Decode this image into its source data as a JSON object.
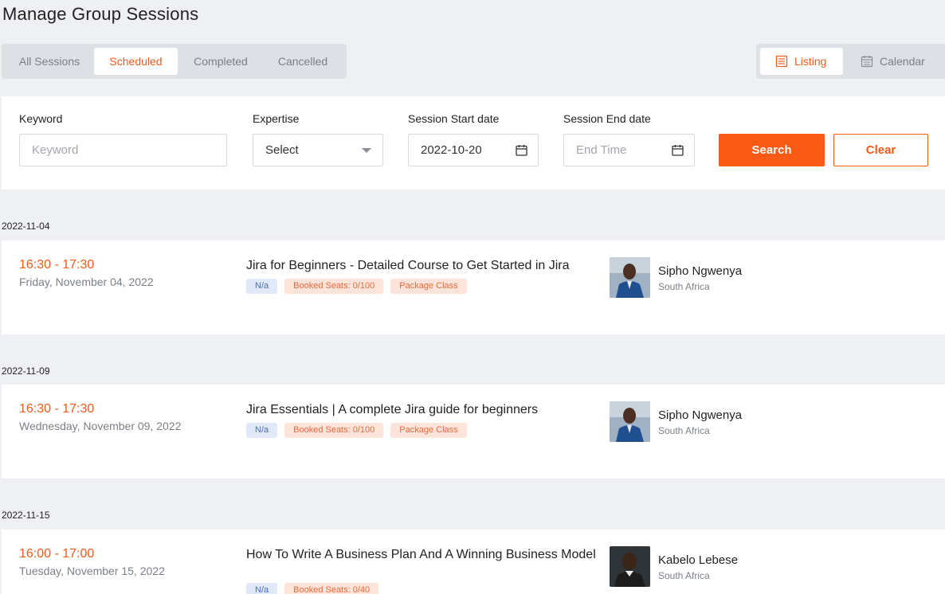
{
  "page": {
    "title": "Manage Group Sessions"
  },
  "tabs": [
    {
      "label": "All Sessions",
      "active": false
    },
    {
      "label": "Scheduled",
      "active": true
    },
    {
      "label": "Completed",
      "active": false
    },
    {
      "label": "Cancelled",
      "active": false
    }
  ],
  "views": [
    {
      "label": "Listing",
      "icon": "list-icon",
      "active": true
    },
    {
      "label": "Calendar",
      "icon": "calendar-icon",
      "active": false
    }
  ],
  "filters": {
    "keyword": {
      "label": "Keyword",
      "placeholder": "Keyword",
      "value": ""
    },
    "expertise": {
      "label": "Expertise",
      "value": "Select"
    },
    "start_date": {
      "label": "Session Start date",
      "value": "2022-10-20"
    },
    "end_date": {
      "label": "Session End date",
      "placeholder": "End Time",
      "value": ""
    },
    "search_label": "Search",
    "clear_label": "Clear"
  },
  "sessions": [
    {
      "date": "2022-11-04",
      "time": "16:30 - 17:30",
      "day": "Friday, November 04, 2022",
      "title": "Jira for Beginners - Detailed Course to Get Started in Jira",
      "tags": [
        "N/a",
        "Booked Seats: 0/100",
        "Package Class"
      ],
      "mentor_name": "Sipho Ngwenya",
      "mentor_country": "South Africa"
    },
    {
      "date": "2022-11-09",
      "time": "16:30 - 17:30",
      "day": "Wednesday, November 09, 2022",
      "title": "Jira Essentials | A complete Jira guide for beginners",
      "tags": [
        "N/a",
        "Booked Seats: 0/100",
        "Package Class"
      ],
      "mentor_name": "Sipho Ngwenya",
      "mentor_country": "South Africa"
    },
    {
      "date": "2022-11-15",
      "time": "16:00 - 17:00",
      "day": "Tuesday, November 15, 2022",
      "title": "How To Write A Business Plan And A Winning Business Model",
      "tags": [
        "N/a",
        "Booked Seats: 0/40"
      ],
      "mentor_name": "Kabelo Lebese",
      "mentor_country": "South Africa"
    }
  ],
  "colors": {
    "accent": "#fa5a14",
    "tag_blue_bg": "#e1e8f7",
    "tag_orange_bg": "#fde4da"
  }
}
